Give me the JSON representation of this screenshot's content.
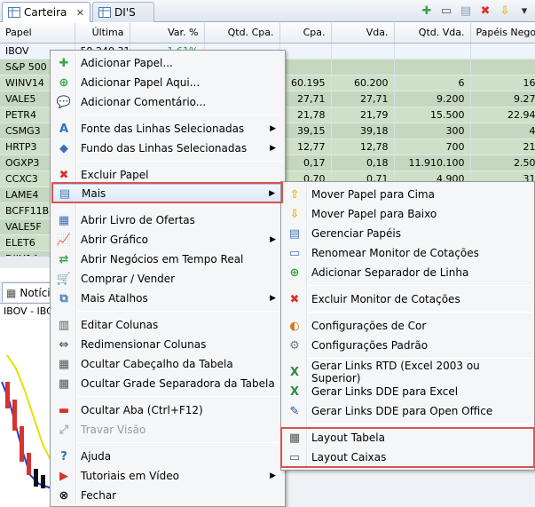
{
  "tabs": [
    {
      "label": "Carteira",
      "icon": "table-icon"
    },
    {
      "label": "DI'S",
      "icon": "table-icon"
    }
  ],
  "toolbar_icons": [
    "add-icon",
    "add-here-icon",
    "comment-icon",
    "delete-icon",
    "move-down-icon",
    "menu-icon"
  ],
  "grid": {
    "columns": [
      "Papel",
      "Última",
      "Var. %",
      "Qtd. Cpa.",
      "Cpa.",
      "Vda.",
      "Qtd. Vda.",
      "Papéis Negoc"
    ],
    "rows": [
      [
        "IBOV",
        "59.240,31",
        "1,61%",
        "",
        "",
        "",
        "",
        ""
      ],
      [
        "S&P 500",
        "",
        "",
        "",
        "",
        "",
        "",
        ""
      ],
      [
        "WINV14",
        "",
        "",
        "",
        "60.195",
        "60.200",
        "6",
        "16"
      ],
      [
        "VALE5",
        "",
        "",
        "",
        "27,71",
        "27,71",
        "9.200",
        "9.27"
      ],
      [
        "PETR4",
        "",
        "",
        "",
        "21,78",
        "21,79",
        "15.500",
        "22.94"
      ],
      [
        "CSMG3",
        "",
        "",
        "",
        "39,15",
        "39,18",
        "300",
        "4"
      ],
      [
        "HRTP3",
        "",
        "",
        "",
        "12,77",
        "12,78",
        "700",
        "21"
      ],
      [
        "OGXP3",
        "",
        "",
        "",
        "0,17",
        "0,18",
        "11.910.100",
        "2.50"
      ],
      [
        "CCXC3",
        "",
        "",
        "",
        "0,70",
        "0,71",
        "4.900",
        "31"
      ],
      [
        "LAME4",
        "",
        "",
        "",
        "",
        "",
        "",
        ""
      ],
      [
        "BCFF11B",
        "",
        "",
        "",
        "",
        "",
        "",
        ""
      ],
      [
        "VALE5F",
        "",
        "",
        "",
        "",
        "",
        "",
        ""
      ],
      [
        "ELET6",
        "",
        "",
        "",
        "",
        "",
        "",
        ""
      ],
      [
        "DIJU14",
        "",
        "",
        "",
        "",
        "",
        "",
        ""
      ]
    ]
  },
  "lower": {
    "tab_label": "Notíci",
    "chart_title": "IBOV - IBC"
  },
  "main_menu": {
    "items": [
      {
        "label": "Adicionar Papel...",
        "icon": "add-icon",
        "color": "#3aa34a"
      },
      {
        "label": "Adicionar Papel Aqui...",
        "icon": "add-here-icon",
        "color": "#3aa34a"
      },
      {
        "label": "Adicionar Comentário...",
        "icon": "comment-icon",
        "color": "#8aa0b8"
      },
      {
        "label": "Fonte das Linhas Selecionadas",
        "icon": "font-icon",
        "color": "#2f6fc0",
        "submenu": true
      },
      {
        "label": "Fundo das Linhas Selecionadas",
        "icon": "fill-icon",
        "color": "#3b6fb6",
        "submenu": true
      },
      {
        "label": "Excluir Papel",
        "icon": "delete-icon",
        "color": "#d9322b"
      },
      {
        "label": "Mais",
        "icon": "list-icon",
        "color": "#4a7ab8",
        "submenu": true
      },
      {
        "label": "Abrir Livro de Ofertas",
        "icon": "book-icon",
        "color": "#3b6fb6"
      },
      {
        "label": "Abrir Gráfico",
        "icon": "chart-icon",
        "color": "#2f6fc0",
        "submenu": true
      },
      {
        "label": "Abrir Negócios em Tempo Real",
        "icon": "trades-icon",
        "color": "#3aa34a"
      },
      {
        "label": "Comprar / Vender",
        "icon": "cart-icon",
        "color": "#777777"
      },
      {
        "label": "Mais Atalhos",
        "icon": "shortcuts-icon",
        "color": "#4a7ab8",
        "submenu": true
      },
      {
        "label": "Editar Colunas",
        "icon": "edit-columns-icon",
        "color": "#555555"
      },
      {
        "label": "Redimensionar Colunas",
        "icon": "resize-columns-icon",
        "color": "#555555"
      },
      {
        "label": "Ocultar Cabeçalho da Tabela",
        "icon": "table-header-icon",
        "color": "#555555"
      },
      {
        "label": "Ocultar Grade Separadora da Tabela",
        "icon": "table-grid-icon",
        "color": "#555555"
      },
      {
        "label": "Ocultar Aba (Ctrl+F12)",
        "icon": "hide-tab-icon",
        "color": "#d9322b"
      },
      {
        "label": "Travar Visão",
        "icon": "lock-view-icon",
        "color": "#aaaaaa",
        "disabled": true
      },
      {
        "label": "Ajuda",
        "icon": "help-icon",
        "color": "#2f6fc0"
      },
      {
        "label": "Tutoriais em Vídeo",
        "icon": "video-icon",
        "color": "#d9322b",
        "submenu": true
      },
      {
        "label": "Fechar",
        "icon": "close-icon",
        "color": "#111111"
      }
    ]
  },
  "sub_menu": {
    "items": [
      {
        "label": "Mover Papel para Cima",
        "icon": "move-up-icon",
        "color": "#f0b400"
      },
      {
        "label": "Mover Papel para Baixo",
        "icon": "move-down-icon",
        "color": "#f0b400"
      },
      {
        "label": "Gerenciar Papéis",
        "icon": "manage-icon",
        "color": "#4a7ab8"
      },
      {
        "label": "Renomear Monitor de Cotações",
        "icon": "rename-icon",
        "color": "#4a7ab8"
      },
      {
        "label": "Adicionar Separador de Linha",
        "icon": "separator-icon",
        "color": "#3aa34a"
      },
      {
        "label": "Excluir Monitor de Cotações",
        "icon": "delete-icon",
        "color": "#d9322b"
      },
      {
        "label": "Configurações de Cor",
        "icon": "palette-icon",
        "color": "#d07a2a"
      },
      {
        "label": "Configurações Padrão",
        "icon": "gear-icon",
        "color": "#777777"
      },
      {
        "label": "Gerar Links RTD (Excel 2003 ou Superior)",
        "icon": "excel-icon",
        "color": "#2e8b3e"
      },
      {
        "label": "Gerar Links DDE para Excel",
        "icon": "excel-icon",
        "color": "#2e8b3e"
      },
      {
        "label": "Gerar Links DDE para Open Office",
        "icon": "openoffice-icon",
        "color": "#1f4f8f"
      },
      {
        "label": "Layout Tabela",
        "icon": "layout-table-icon",
        "color": "#555555"
      },
      {
        "label": "Layout Caixas",
        "icon": "layout-boxes-icon",
        "color": "#555555"
      }
    ]
  },
  "highlight_color": "#d9534f"
}
